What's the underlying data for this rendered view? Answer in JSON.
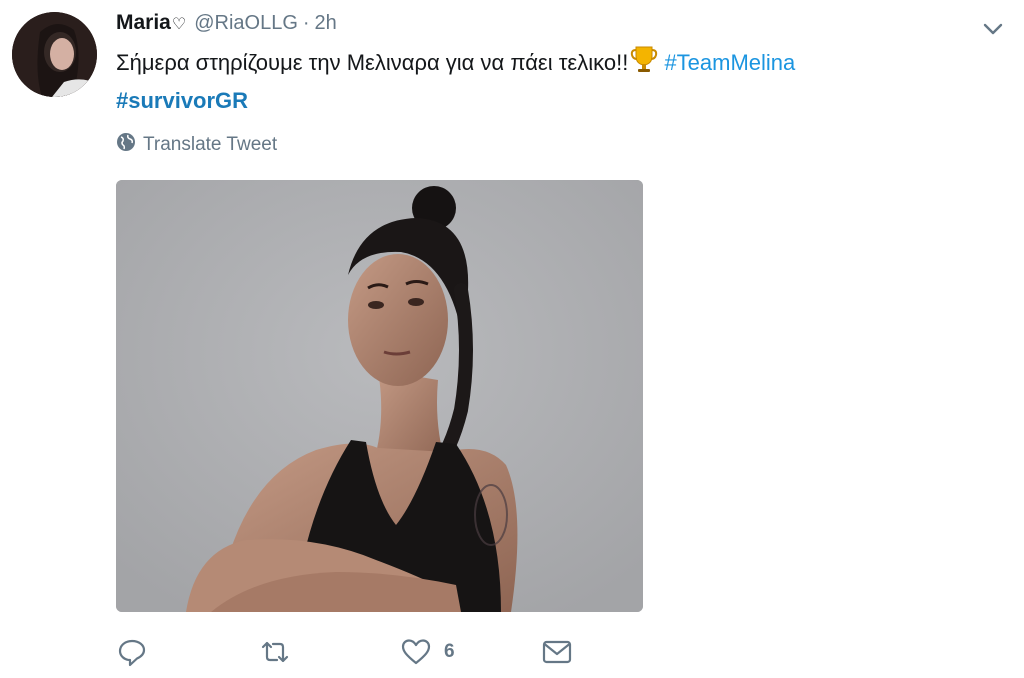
{
  "tweet": {
    "author_name": "Maria",
    "name_emoji": "♡",
    "handle": "@RiaOLLG",
    "separator": "·",
    "time": "2h",
    "text_line1": "Σήμερα στηρίζουμε την Μελιναρα για να πάει τελικο!!",
    "hashtag1": "#TeamMelina",
    "hashtag2": "#survivorGR",
    "translate_label": "Translate Tweet",
    "like_count": "6"
  },
  "icons": {
    "more": "chevron-down-icon",
    "translate": "globe-icon",
    "trophy": "trophy-emoji",
    "reply": "reply-icon",
    "retweet": "retweet-icon",
    "like": "heart-icon",
    "dm": "envelope-icon"
  },
  "colors": {
    "hashtag": "#1b95e0",
    "secondary_text": "#657786",
    "primary_text": "#14171a"
  }
}
